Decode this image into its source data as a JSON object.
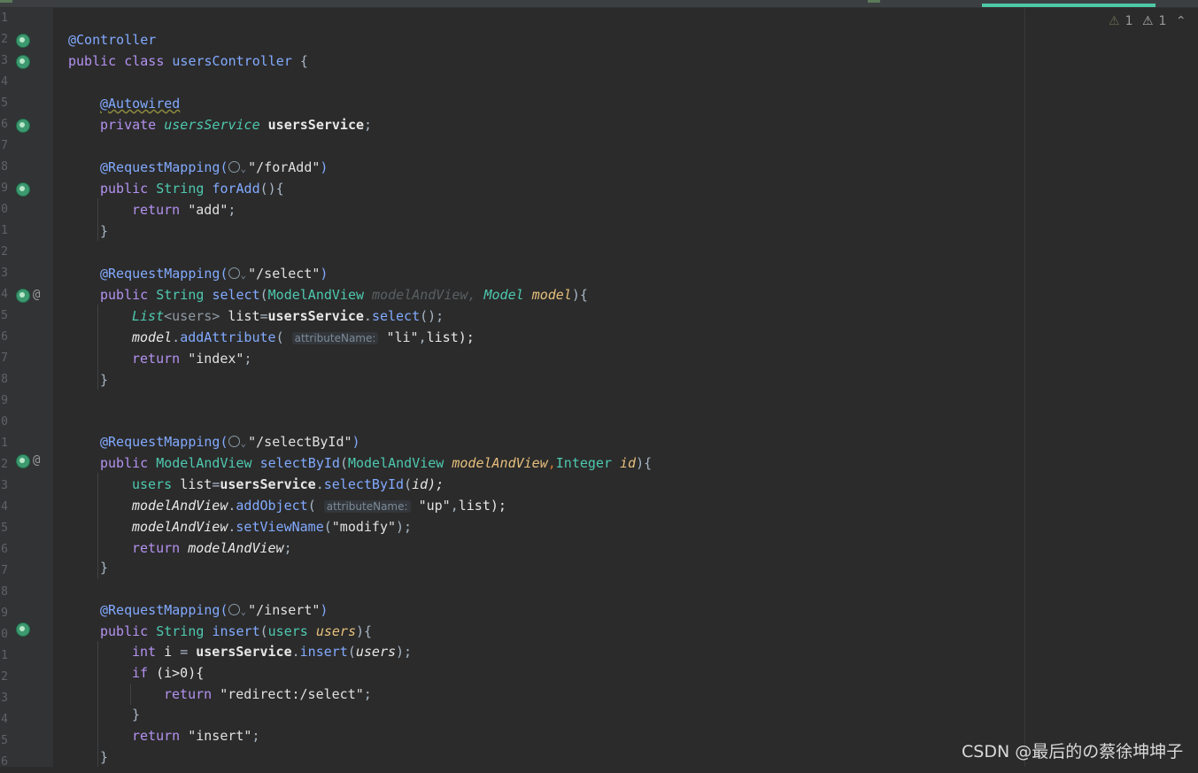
{
  "editor": {
    "line_numbers": [
      "1",
      "2",
      "3",
      "4",
      "5",
      "6",
      "7",
      "8",
      "9",
      "0",
      "1",
      "2",
      "3",
      "4",
      "5",
      "6",
      "7",
      "8",
      "9",
      "0",
      "1",
      "2",
      "3",
      "4",
      "5",
      "6",
      "7",
      "8",
      "9",
      "0",
      "1",
      "2",
      "3",
      "4",
      "5",
      "6",
      "7"
    ],
    "code": {
      "l2": "@Controller",
      "l3_public": "public",
      "l3_class": "class",
      "l3_name": "usersController",
      "l3_brace": "{",
      "l5": "@Autowired",
      "l6_private": "private",
      "l6_type": "usersService",
      "l6_field": "usersService",
      "l6_semi": ";",
      "rm_prefix": "@RequestMapping(",
      "rm_forAdd": "\"/forAdd\"",
      "rm_select": "\"/select\"",
      "rm_selectById": "\"/selectById\"",
      "rm_insert": "\"/insert\"",
      "rm_suffix": ")",
      "public": "public",
      "String": "String",
      "forAdd": "forAdd",
      "forAdd_sig": "(){",
      "return": "return",
      "ret_add": "\"add\"",
      "semi": ";",
      "close": "}",
      "select": "select",
      "ModelAndView": "ModelAndView",
      "modelAndView": "modelAndView",
      "comma": ",",
      "Model": "Model",
      "model": "model",
      "sig_end": "){",
      "List": "List",
      "users_generic": "<users>",
      "list": "list",
      "eq": "=",
      "usersService": "usersService",
      "dot": ".",
      "select_call": "select",
      "call_end": "();",
      "addAttribute": "addAttribute",
      "hint_attr": "attributeName:",
      "str_li": "\"li\"",
      "list_end": "list);",
      "ret_index": "\"index\"",
      "selectById": "selectById",
      "Integer": "Integer",
      "id": "id",
      "users": "users",
      "selectById_call": "selectById",
      "id_end": "id);",
      "addObject": "addObject",
      "str_up": "\"up\"",
      "setViewName": "setViewName",
      "str_modify": "\"modify\"",
      "paren_close_semi": ");",
      "insert": "insert",
      "int": "int",
      "i": "i",
      "insert_call": "insert",
      "users_arg": "users",
      "if": "if",
      "cond": "(i>0){",
      "ret_redirect": "\"redirect:/select\"",
      "ret_insert": "\"insert\"",
      "open_paren": "("
    }
  },
  "inspections": {
    "weak_warnings": "1",
    "warnings": "1"
  },
  "watermark": "CSDN @最后的の蔡徐坤坤子",
  "colors": {
    "background": "#2b2b2b",
    "gutter": "#313335",
    "active_tab": "#4ec9a6",
    "spring_icon": "#3d9970"
  }
}
